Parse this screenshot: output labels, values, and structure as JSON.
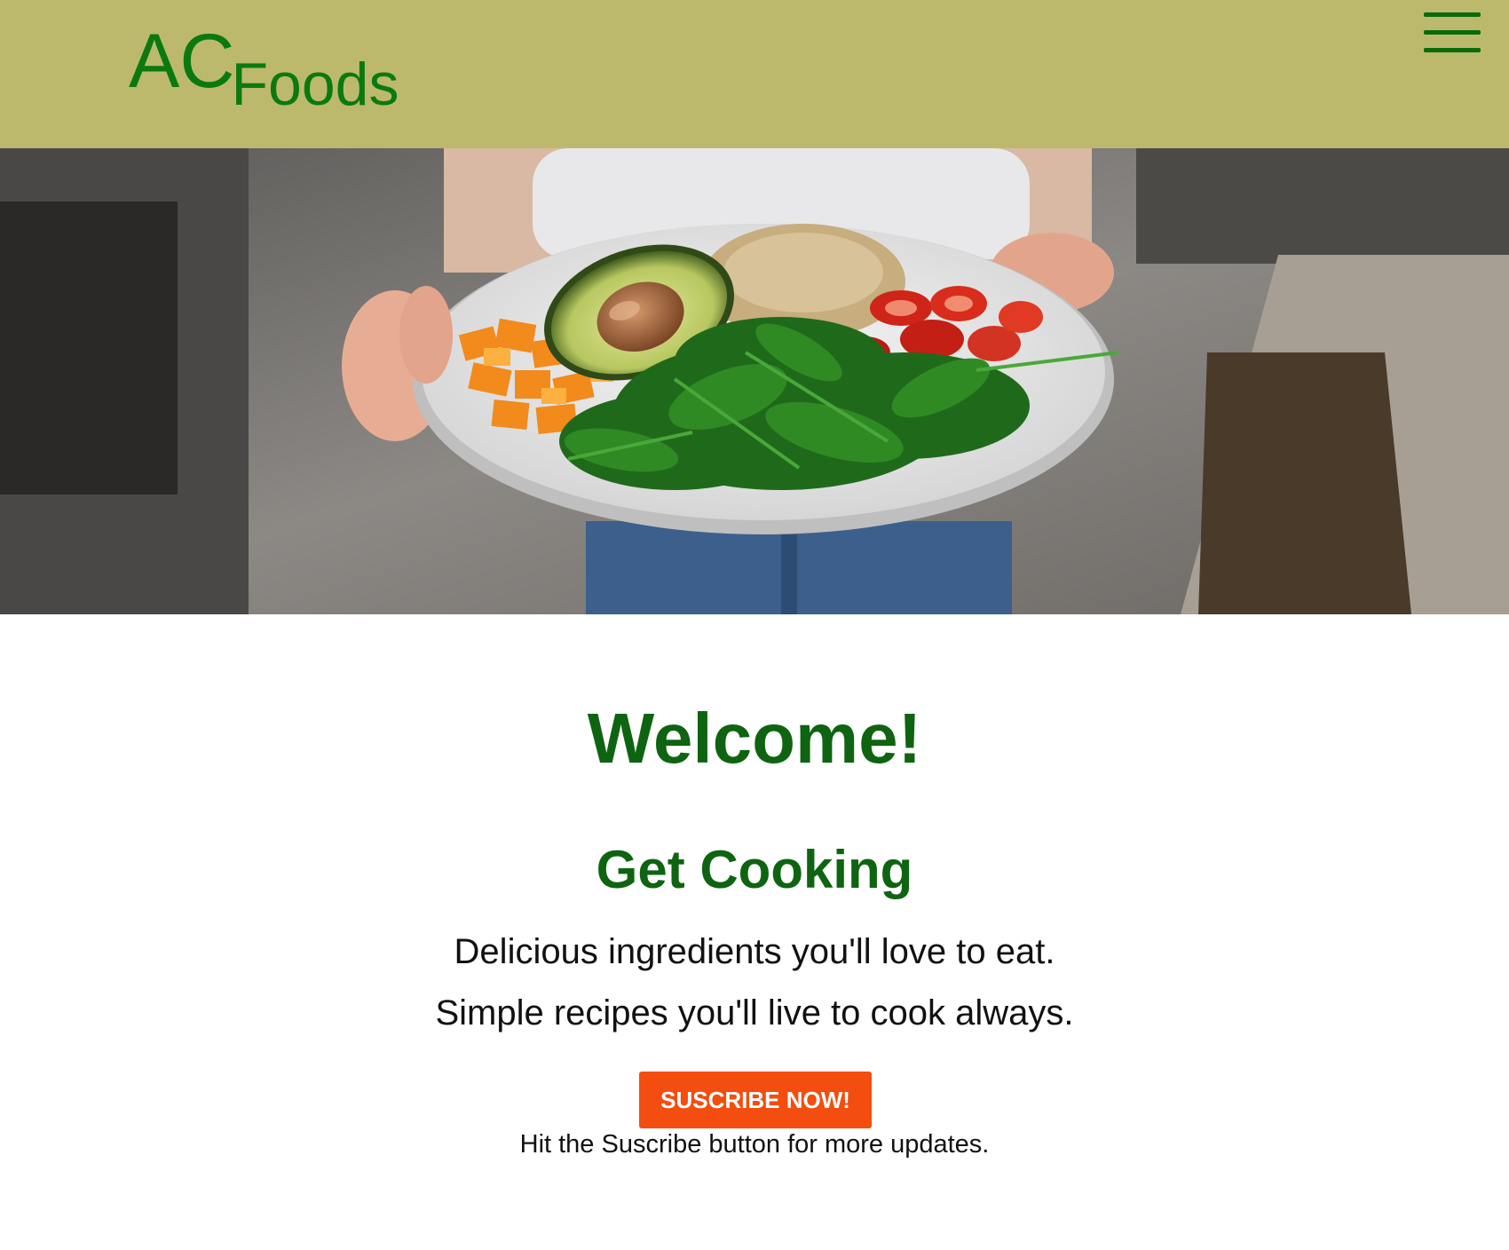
{
  "header": {
    "logo_primary": "AC",
    "logo_secondary": "Foods",
    "menu_icon": "hamburger-menu-icon"
  },
  "hero": {
    "image_subject": "salad-bowl-photo"
  },
  "main": {
    "welcome": "Welcome!",
    "heading": "Get Cooking",
    "tagline_1": "Delicious ingredients you'll love to eat.",
    "tagline_2": "Simple recipes you'll live to cook always.",
    "subscribe_label": "SUSCRIBE NOW!",
    "hint": "Hit the Suscribe button for more updates."
  },
  "colors": {
    "header_bg": "#bdb96c",
    "brand_green": "#0a7a10",
    "heading_green": "#0e6410",
    "button_orange": "#f34d0f"
  }
}
